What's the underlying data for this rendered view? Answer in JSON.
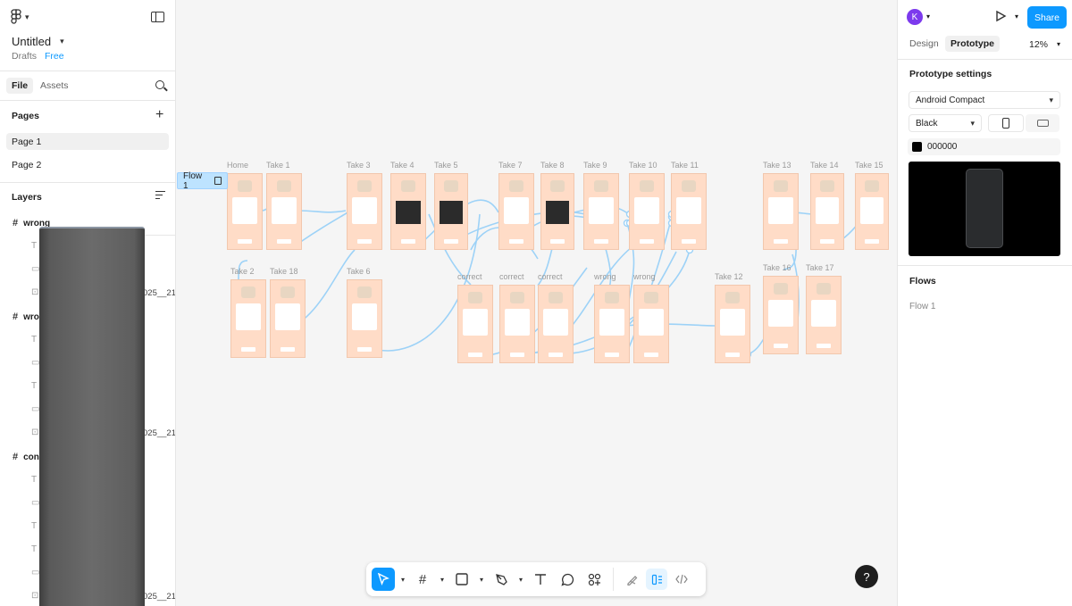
{
  "app": {
    "file_title": "Untitled",
    "location": "Drafts",
    "plan": "Free"
  },
  "left_panel": {
    "tabs": [
      "File",
      "Assets"
    ],
    "pages_title": "Pages",
    "pages": [
      "Page 1",
      "Page 2"
    ],
    "selected_page": "Page 1",
    "layers_title": "Layers",
    "layers": [
      {
        "name": "wrong",
        "children": [
          {
            "icon": "text-icon",
            "text": ""
          },
          {
            "icon": "rectangle-icon",
            "text": ""
          },
          {
            "icon": "image-icon",
            "text": "025__21."
          }
        ]
      },
      {
        "name": "wro",
        "children": [
          {
            "icon": "text-icon",
            "text": ""
          },
          {
            "icon": "rectangle-icon",
            "text": ""
          },
          {
            "icon": "text-icon",
            "text": ""
          },
          {
            "icon": "rectangle-icon",
            "text": ""
          },
          {
            "icon": "image-icon",
            "text": "025__21."
          }
        ]
      },
      {
        "name": "con",
        "children": [
          {
            "icon": "text-icon",
            "text": ""
          },
          {
            "icon": "rectangle-icon",
            "text": ""
          },
          {
            "icon": "text-icon",
            "text": ""
          },
          {
            "icon": "text-icon",
            "text": ""
          },
          {
            "icon": "rectangle-icon",
            "text": ""
          },
          {
            "icon": "image-icon",
            "text": "025__21."
          }
        ]
      }
    ]
  },
  "canvas": {
    "flow_label": "Flow 1",
    "frames": [
      {
        "label": "Home",
        "variant": "hello"
      },
      {
        "label": "Take 1",
        "variant": "text"
      },
      {
        "label": "Take 3",
        "variant": "gifts"
      },
      {
        "label": "Take 4",
        "variant": "photo"
      },
      {
        "label": "Take 5",
        "variant": "photo"
      },
      {
        "label": "Take 7",
        "variant": "text"
      },
      {
        "label": "Take 8",
        "variant": "dark"
      },
      {
        "label": "Take 9",
        "variant": "options"
      },
      {
        "label": "Take 10",
        "variant": "options"
      },
      {
        "label": "Take 11",
        "variant": "options"
      },
      {
        "label": "Take 13",
        "variant": "gifts"
      },
      {
        "label": "Take 14",
        "variant": "gift"
      },
      {
        "label": "Take 15",
        "variant": "text"
      },
      {
        "label": "Take 2",
        "variant": "gift"
      },
      {
        "label": "Take 18",
        "variant": "gift"
      },
      {
        "label": "Take 6",
        "variant": "text"
      },
      {
        "label": "correct",
        "variant": "answer"
      },
      {
        "label": "correct",
        "variant": "answer"
      },
      {
        "label": "correct",
        "variant": "answer"
      },
      {
        "label": "wrong",
        "variant": "answer"
      },
      {
        "label": "wrong",
        "variant": "answer"
      },
      {
        "label": "Take 12",
        "variant": "answer"
      },
      {
        "label": "Take 16",
        "variant": "text"
      },
      {
        "label": "Take 17",
        "variant": "answer"
      }
    ]
  },
  "toolbar": {
    "tools": [
      "move-tool",
      "frame-tool",
      "shape-tool",
      "pen-tool",
      "text-tool",
      "comment-tool",
      "actions-tool"
    ],
    "modes": [
      "draw-mode",
      "design-mode",
      "dev-mode"
    ]
  },
  "right_panel": {
    "user_initial": "K",
    "share_label": "Share",
    "tabs": [
      "Design",
      "Prototype"
    ],
    "active_tab": "Prototype",
    "zoom": "12%",
    "settings_title": "Prototype settings",
    "device": "Android Compact",
    "device_color": "Black",
    "background_hex": "000000",
    "flows_title": "Flows",
    "flows": [
      "Flow 1"
    ]
  },
  "help": "?"
}
